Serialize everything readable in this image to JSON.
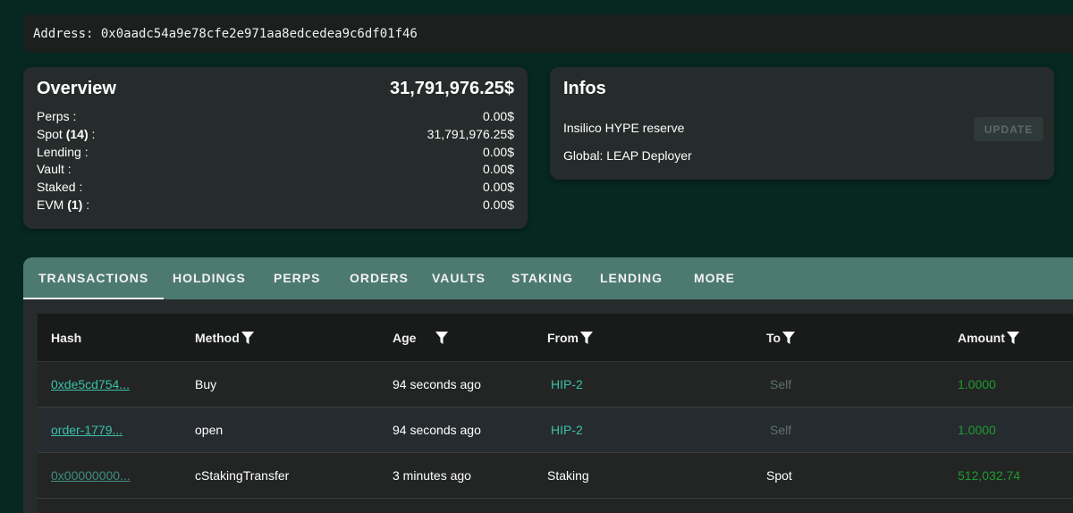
{
  "address": "Address: 0x0aadc54a9e78cfe2e971aa8edcedea9c6df01f46",
  "overview": {
    "title": "Overview",
    "total": "31,791,976.25$",
    "rows": [
      {
        "label": "Perps :",
        "value": "0.00$"
      },
      {
        "label_pre": "Spot ",
        "label_bold": "(14)",
        "label_post": " :",
        "value": "31,791,976.25$"
      },
      {
        "label": "Lending :",
        "value": "0.00$"
      },
      {
        "label": "Vault :",
        "value": "0.00$"
      },
      {
        "label": "Staked :",
        "value": "0.00$"
      },
      {
        "label_pre": "EVM ",
        "label_bold": "(1)",
        "label_post": " :",
        "value": "0.00$"
      }
    ]
  },
  "infos": {
    "title": "Infos",
    "line1": "Insilico HYPE reserve",
    "line2": "Global: LEAP Deployer",
    "update_label": "UPDATE"
  },
  "tabs": [
    "TRANSACTIONS",
    "HOLDINGS",
    "PERPS",
    "ORDERS",
    "VAULTS",
    "STAKING",
    "LENDING",
    "MORE"
  ],
  "table": {
    "headers": [
      "Hash",
      "Method",
      "Age",
      "From",
      "To",
      "Amount"
    ],
    "rows": [
      {
        "hash": "0xde5cd754...",
        "method": "Buy",
        "age": "94 seconds ago",
        "from": "HIP-2",
        "to": "Self",
        "amount": "1.0000"
      },
      {
        "hash": "order-1779...",
        "method": "open",
        "age": "94 seconds ago",
        "from": "HIP-2",
        "to": "Self",
        "amount": "1.0000"
      },
      {
        "hash": "0x00000000...",
        "method": "cStakingTransfer",
        "age": "3 minutes ago",
        "from": "Staking",
        "to": "Spot",
        "amount": "512,032.74"
      }
    ]
  },
  "colors": {
    "background": "#062820",
    "card": "#262c2b",
    "tab_bar": "#4d7a70",
    "link": "#3cc0a8",
    "amount": "#1e9a2e"
  }
}
